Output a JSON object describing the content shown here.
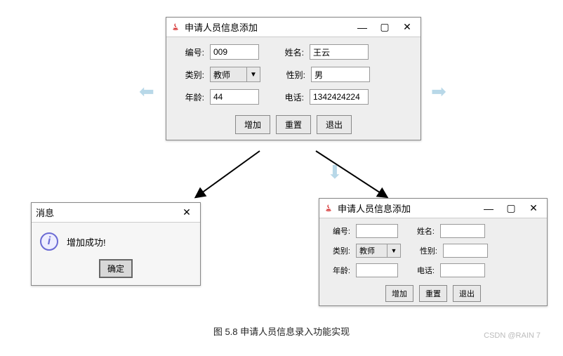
{
  "windowTop": {
    "title": "申请人员信息添加",
    "labels": {
      "id": "编号:",
      "name": "姓名:",
      "category": "类别:",
      "sex": "性别:",
      "age": "年龄:",
      "phone": "电话:"
    },
    "values": {
      "id": "009",
      "name": "王云",
      "category": "教师",
      "sex": "男",
      "age": "44",
      "phone": "1342424224"
    },
    "buttons": {
      "add": "增加",
      "reset": "重置",
      "exit": "退出"
    }
  },
  "messageDialog": {
    "title": "消息",
    "text": "增加成功!",
    "ok": "确定"
  },
  "windowBottom": {
    "title": "申请人员信息添加",
    "labels": {
      "id": "编号:",
      "name": "姓名:",
      "category": "类别:",
      "sex": "性别:",
      "age": "年龄:",
      "phone": "电话:"
    },
    "values": {
      "id": "",
      "name": "",
      "category": "教师",
      "sex": "",
      "age": "",
      "phone": ""
    },
    "buttons": {
      "add": "增加",
      "reset": "重置",
      "exit": "退出"
    }
  },
  "caption": "图 5.8 申请人员信息录入功能实现",
  "watermark": "CSDN @RAIN 7"
}
